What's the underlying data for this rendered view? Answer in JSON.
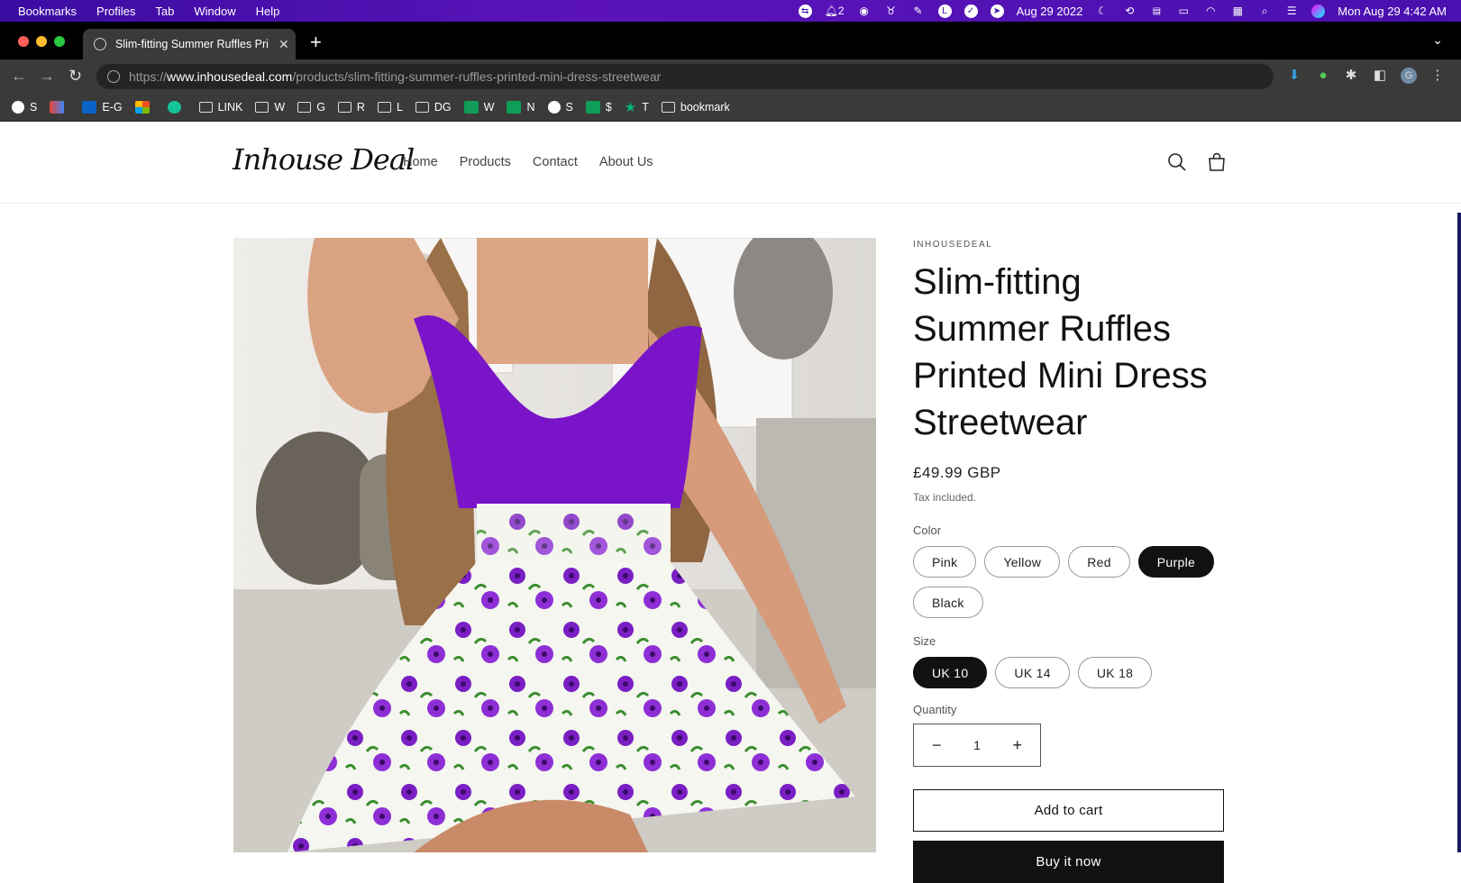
{
  "menubar": {
    "items": [
      "Bookmarks",
      "Profiles",
      "Tab",
      "Window",
      "Help"
    ],
    "notification_count": "2",
    "date": "Aug 29 2022",
    "clock": "Mon Aug 29  4:42 AM"
  },
  "browser": {
    "tab_title": "Slim-fitting Summer Ruffles Pri",
    "url_scheme": "https://",
    "url_host": "www.inhousedeal.com",
    "url_path": "/products/slim-fitting-summer-ruffles-printed-mini-dress-streetwear",
    "profile_initial": "G"
  },
  "bookmarks": [
    {
      "label": "S",
      "icon": "globe-icon"
    },
    {
      "label": "",
      "icon": "gmail-icon"
    },
    {
      "label": "E-G",
      "icon": "outlook-icon"
    },
    {
      "label": "",
      "icon": "microsoft-icon"
    },
    {
      "label": "",
      "icon": "grammarly-icon"
    },
    {
      "label": "LINK",
      "icon": "folder-icon"
    },
    {
      "label": "W",
      "icon": "folder-icon"
    },
    {
      "label": "G",
      "icon": "folder-icon"
    },
    {
      "label": "R",
      "icon": "folder-icon"
    },
    {
      "label": "L",
      "icon": "folder-icon"
    },
    {
      "label": "DG",
      "icon": "folder-icon"
    },
    {
      "label": "W",
      "icon": "green-cross-icon"
    },
    {
      "label": "N",
      "icon": "green-cross-icon"
    },
    {
      "label": "S",
      "icon": "globe-icon"
    },
    {
      "label": "$",
      "icon": "green-cross-icon"
    },
    {
      "label": "T",
      "icon": "star-icon"
    },
    {
      "label": "bookmark",
      "icon": "folder-icon"
    }
  ],
  "site": {
    "logo": "Inhouse Deal",
    "nav": [
      "Home",
      "Products",
      "Contact",
      "About Us"
    ]
  },
  "product": {
    "vendor": "INHOUSEDEAL",
    "title": "Slim-fitting Summer Ruffles Printed Mini Dress Streetwear",
    "price": "£49.99 GBP",
    "tax_note": "Tax included.",
    "color_label": "Color",
    "colors": [
      "Pink",
      "Yellow",
      "Red",
      "Purple",
      "Black"
    ],
    "selected_color": "Purple",
    "size_label": "Size",
    "sizes": [
      "UK 10",
      "UK 14",
      "UK 18"
    ],
    "selected_size": "UK 10",
    "quantity_label": "Quantity",
    "quantity": "1",
    "add_to_cart": "Add to cart",
    "buy_now": "Buy it now"
  },
  "colors": {
    "menubar": "#4a10b0",
    "dress_purple": "#7a14c8",
    "selected_pill": "#111111"
  }
}
